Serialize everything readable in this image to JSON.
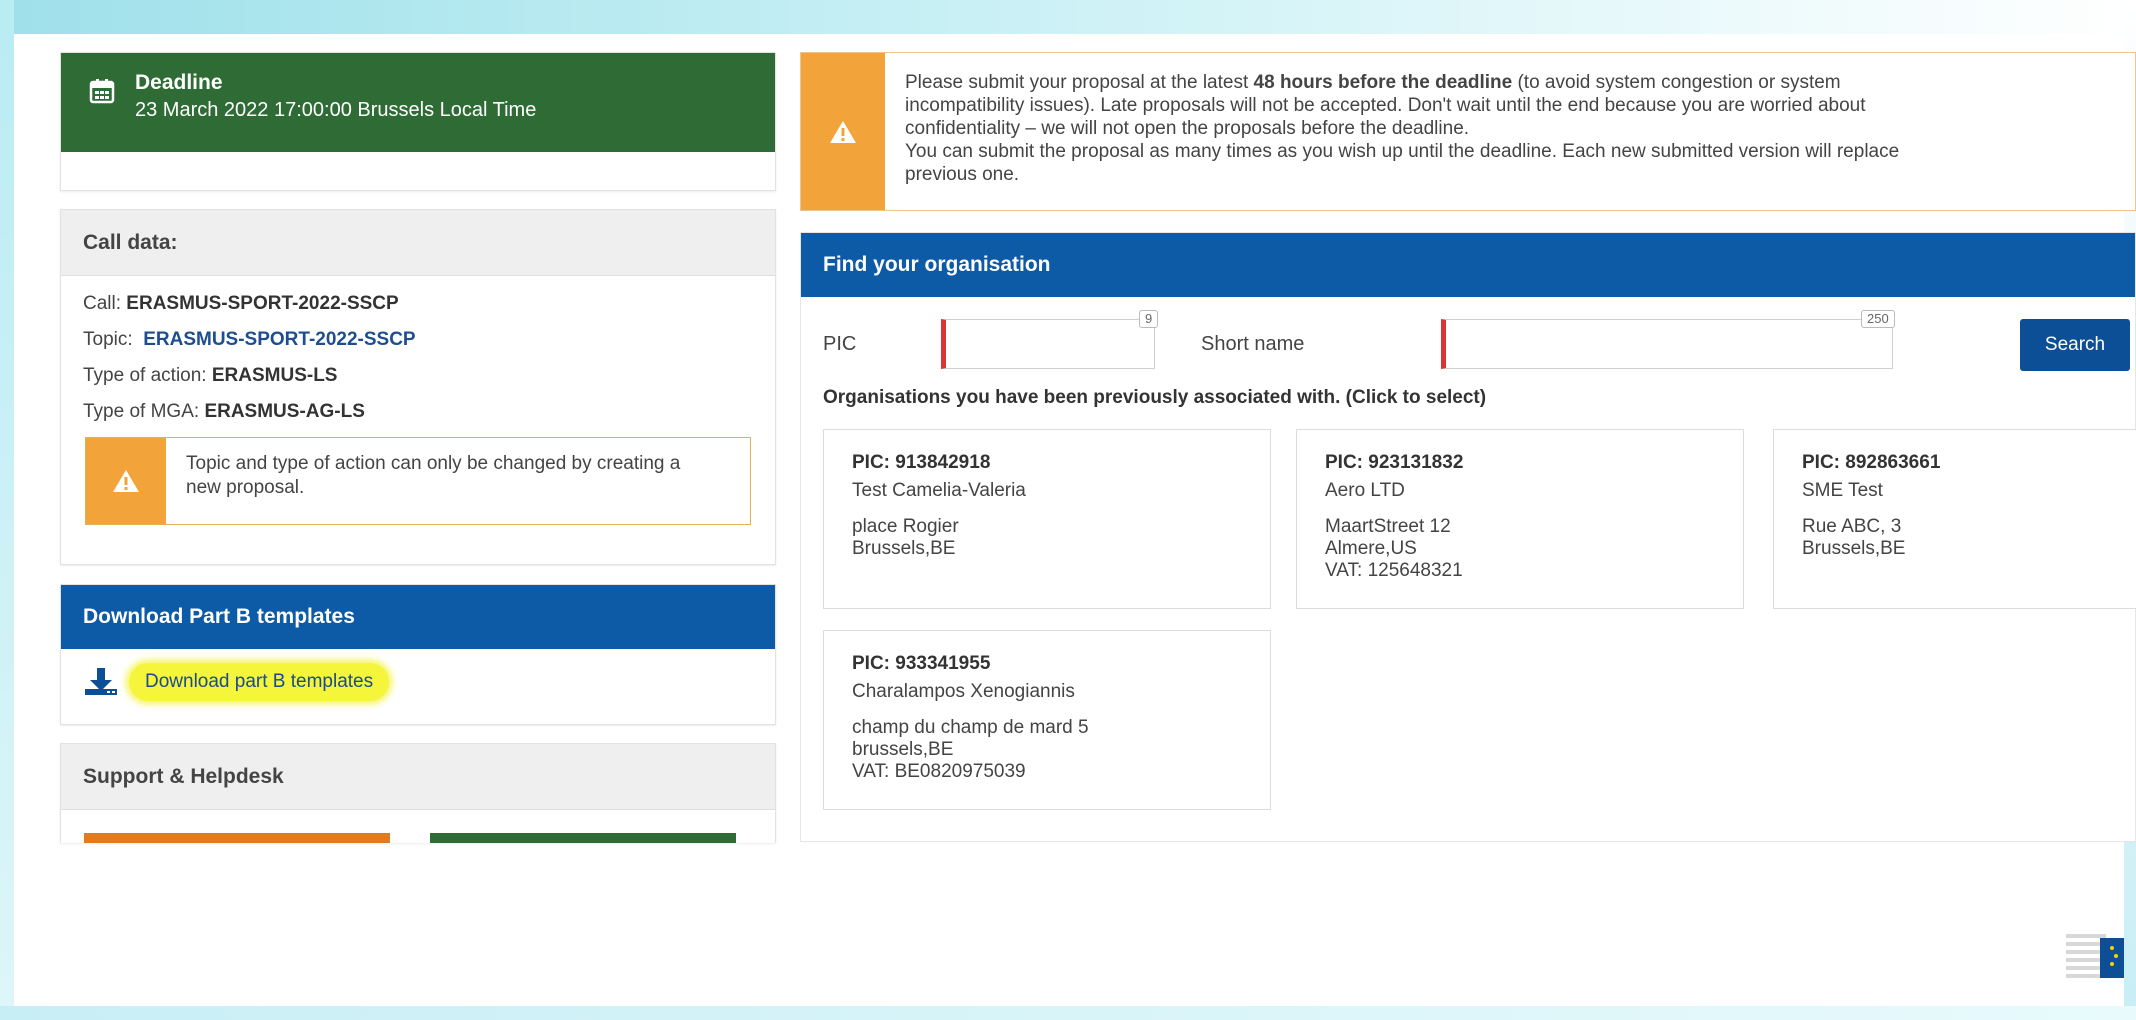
{
  "deadline": {
    "title": "Deadline",
    "date": "23 March 2022 17:00:00 Brussels Local Time"
  },
  "call_data": {
    "heading": "Call data:",
    "call_label": "Call: ",
    "call_value": "ERASMUS-SPORT-2022-SSCP",
    "topic_label": "Topic: ",
    "topic_value": "ERASMUS-SPORT-2022-SSCP",
    "action_label": "Type of action: ",
    "action_value": "ERASMUS-LS",
    "mga_label": "Type of MGA: ",
    "mga_value": "ERASMUS-AG-LS",
    "notice": "Topic and type of action can only be changed by creating a new proposal."
  },
  "download": {
    "heading": "Download Part B templates",
    "link_label": "Download part B templates"
  },
  "support": {
    "heading": "Support & Helpdesk"
  },
  "warning": {
    "line1_pre": "Please submit your proposal at the latest ",
    "line1_bold": "48 hours before the deadline",
    "line1_post": " (to avoid system congestion or system",
    "line2": "incompatibility issues). Late proposals will not be accepted. Don't wait until the end because you are worried about",
    "line3": "confidentiality – we will not open the proposals before the deadline.",
    "line4": "You can submit the proposal as many times as you wish up until the deadline. Each new submitted version will replace",
    "line5": "previous one."
  },
  "find": {
    "heading": "Find your organisation",
    "pic_label": "PIC",
    "pic_max": "9",
    "short_label": "Short name",
    "short_max": "250",
    "search_label": "Search",
    "assoc_title": "Organisations you have been previously associated with. (Click to select)"
  },
  "organisations": [
    {
      "pic": "PIC: 913842918",
      "name": "Test Camelia-Valeria",
      "addr1": "place Rogier",
      "addr2": "Brussels,BE",
      "vat": ""
    },
    {
      "pic": "PIC: 923131832",
      "name": "Aero LTD",
      "addr1": "MaartStreet 12",
      "addr2": "Almere,US",
      "vat": "VAT: 125648321"
    },
    {
      "pic": "PIC: 892863661",
      "name": "SME Test",
      "addr1": "Rue ABC, 3",
      "addr2": "Brussels,BE",
      "vat": ""
    },
    {
      "pic": "PIC: 933341955",
      "name": "Charalampos Xenogiannis",
      "addr1": "champ du champ de mard 5",
      "addr2": "brussels,BE",
      "vat": "VAT: BE0820975039"
    }
  ],
  "colors": {
    "green_header": "#2e6b35",
    "blue_header": "#0d5aa7",
    "warning_orange": "#f2a33a",
    "required_red": "#d33333",
    "highlight_yellow": "#f5f53c",
    "button_orange": "#e07b1f",
    "button_green": "#2e6b35"
  }
}
